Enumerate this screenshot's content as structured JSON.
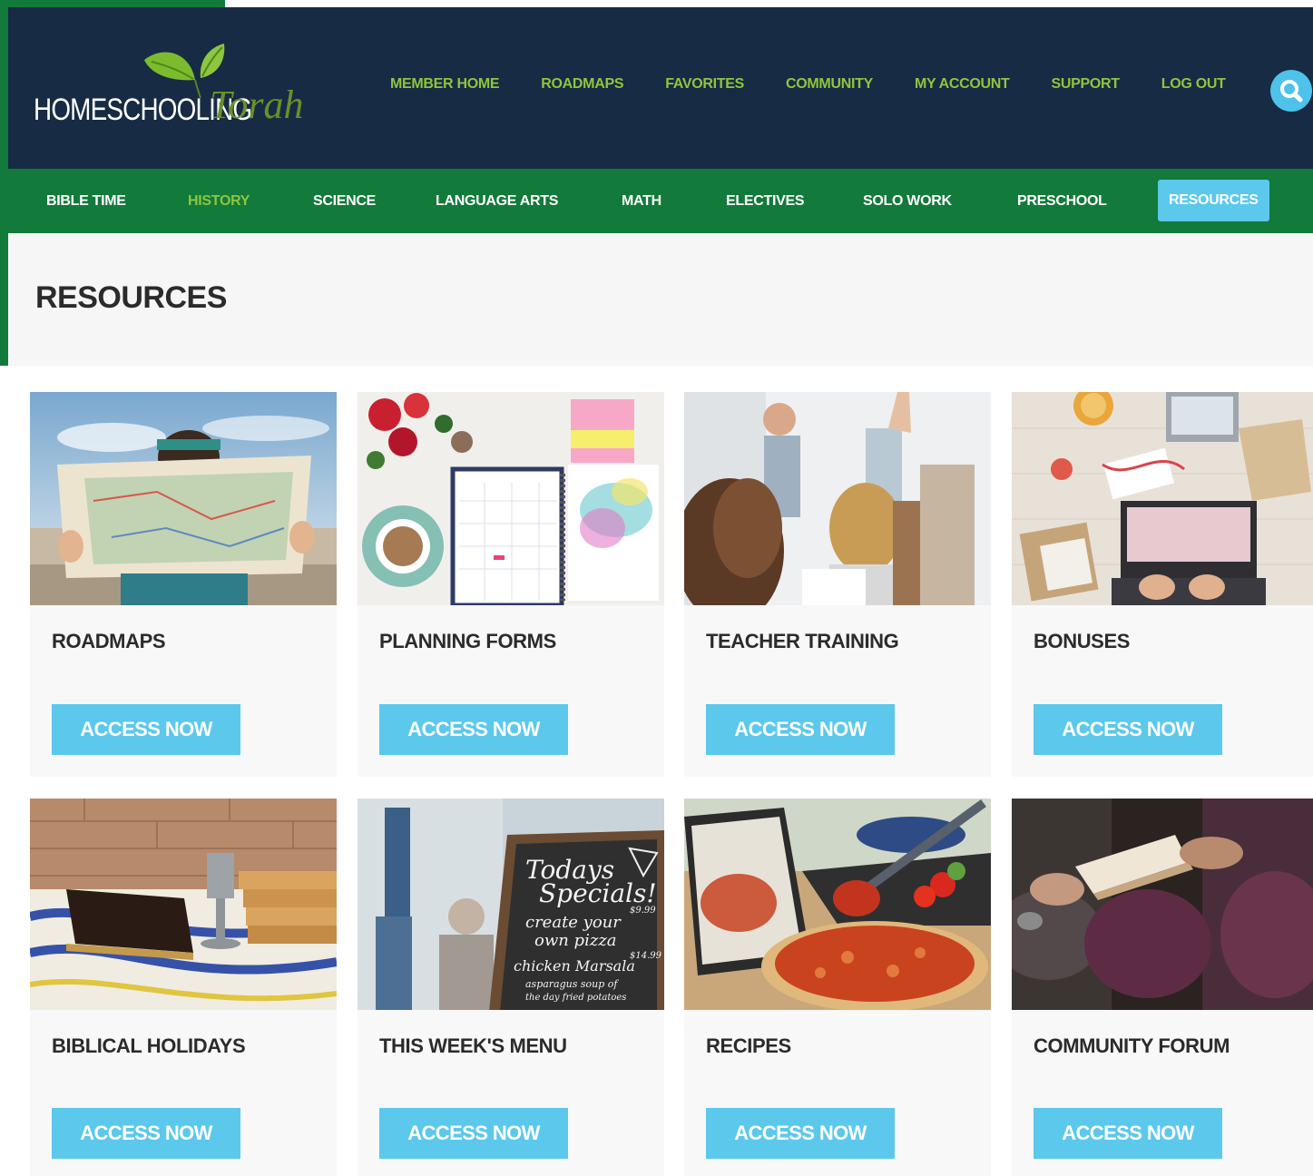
{
  "brand": {
    "logo_text": "HOMESCHOOLING",
    "logo_script": "Torah",
    "colors": {
      "navy": "#172b44",
      "green": "#127a3a",
      "lime": "#8dc63f",
      "sky": "#5bc8ec"
    }
  },
  "top_nav": {
    "items": [
      "MEMBER HOME",
      "ROADMAPS",
      "FAVORITES",
      "COMMUNITY",
      "MY ACCOUNT",
      "SUPPORT",
      "LOG OUT"
    ],
    "search_icon": "search-icon"
  },
  "sub_nav": {
    "items": [
      "BIBLE TIME",
      "HISTORY",
      "SCIENCE",
      "LANGUAGE ARTS",
      "MATH",
      "ELECTIVES",
      "SOLO WORK",
      "PRESCHOOL",
      "RESOURCES"
    ],
    "highlighted": "HISTORY",
    "active": "RESOURCES"
  },
  "page": {
    "title": "RESOURCES"
  },
  "cards": [
    {
      "title": "ROADMAPS",
      "button": "ACCESS NOW",
      "image": "person-reading-map"
    },
    {
      "title": "PLANNING FORMS",
      "button": "ACCESS NOW",
      "image": "planner-with-coffee"
    },
    {
      "title": "TEACHER TRAINING",
      "button": "ACCESS NOW",
      "image": "classroom-raised-hand"
    },
    {
      "title": "BONUSES",
      "button": "ACCESS NOW",
      "image": "laptop-with-gifts"
    },
    {
      "title": "BIBLICAL HOLIDAYS",
      "button": "ACCESS NOW",
      "image": "matzah-and-kiddush-cup"
    },
    {
      "title": "THIS WEEK'S MENU",
      "button": "ACCESS NOW",
      "image": "chalkboard-menu"
    },
    {
      "title": "RECIPES",
      "button": "ACCESS NOW",
      "image": "pizza-and-tablet"
    },
    {
      "title": "COMMUNITY FORUM",
      "button": "ACCESS NOW",
      "image": "people-reading-bible"
    }
  ],
  "chalkboard": {
    "line1": "Todays",
    "line2": "Specials!",
    "line3": "create your",
    "line4": "own pizza",
    "line5": "chicken Marsala",
    "line6": "asparagus soup of",
    "line7": "the day fried potatoes",
    "price1": "$9.99",
    "price2": "$14.99"
  }
}
